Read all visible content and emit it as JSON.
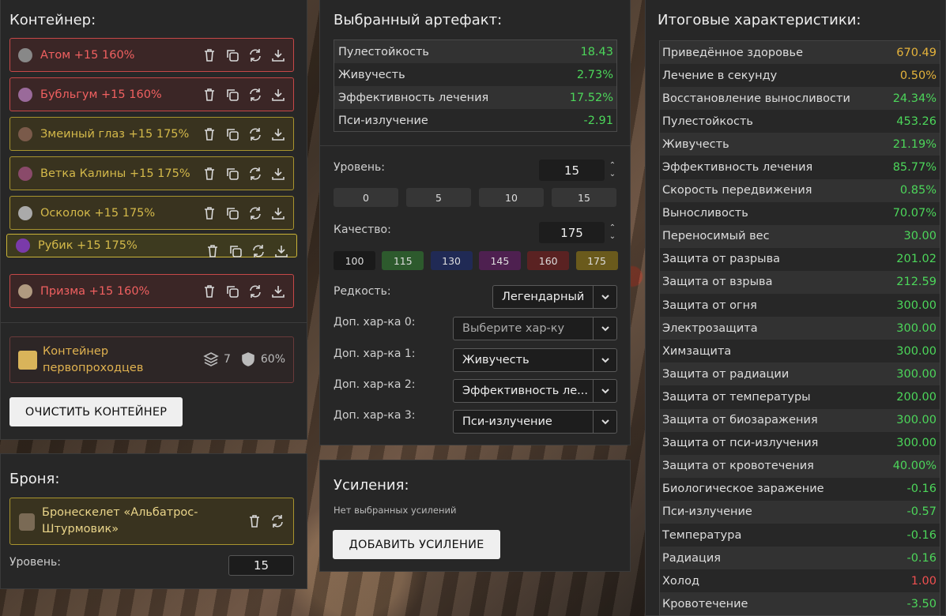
{
  "container": {
    "title": "Контейнер:",
    "artifacts": [
      {
        "name": "Атом +15 160%",
        "tier": "red",
        "color": "#888888"
      },
      {
        "name": "Бубльгум +15 160%",
        "tier": "red",
        "color": "#9a6a9a"
      },
      {
        "name": "Змеиный глаз +15 175%",
        "tier": "yellow",
        "color": "#7a5a4a"
      },
      {
        "name": "Ветка Калины +15 175%",
        "tier": "yellow",
        "color": "#8a4a6a"
      },
      {
        "name": "Осколок +15 175%",
        "tier": "yellow",
        "color": "#aaaaaa"
      },
      {
        "name": "Рубик +15 175%",
        "tier": "selected",
        "color": "#7a3aaa"
      },
      {
        "name": "Призма +15 160%",
        "tier": "red",
        "color": "#b09a80"
      }
    ],
    "card": {
      "name": "Контейнер первопроходцев",
      "slots": "7",
      "protection": "60%"
    },
    "clear_label": "ОЧИСТИТЬ КОНТЕЙНЕР"
  },
  "armor": {
    "title": "Броня:",
    "name": "Бронескелет «Альбатрос-Штурмовик»",
    "level_label": "Уровень:",
    "level": "15"
  },
  "selected": {
    "title": "Выбранный артефакт:",
    "rows": [
      {
        "label": "Пулестойкость",
        "value": "18.43"
      },
      {
        "label": "Живучесть",
        "value": "2.73%"
      },
      {
        "label": "Эффективность лечения",
        "value": "17.52%"
      },
      {
        "label": "Пси-излучение",
        "value": "-2.91"
      }
    ],
    "level_label": "Уровень:",
    "level": "15",
    "level_presets": [
      "0",
      "5",
      "10",
      "15"
    ],
    "quality_label": "Качество:",
    "quality": "175",
    "quality_presets": [
      {
        "v": "100",
        "c": "#1a1a1a"
      },
      {
        "v": "115",
        "c": "#2d5a2d"
      },
      {
        "v": "130",
        "c": "#202a55"
      },
      {
        "v": "145",
        "c": "#4e2050"
      },
      {
        "v": "160",
        "c": "#5a2222"
      },
      {
        "v": "175",
        "c": "#6a5a1c"
      }
    ],
    "rarity_label": "Редкость:",
    "rarity": "Легендарный",
    "extras": [
      {
        "label": "Доп. хар-ка 0:",
        "value": "Выберите хар-ку",
        "placeholder": true
      },
      {
        "label": "Доп. хар-ка 1:",
        "value": "Живучесть"
      },
      {
        "label": "Доп. хар-ка 2:",
        "value": "Эффективность ле..."
      },
      {
        "label": "Доп. хар-ка 3:",
        "value": "Пси-излучение"
      }
    ]
  },
  "boosts": {
    "title": "Усиления:",
    "empty": "Нет выбранных усилений",
    "add_label": "ДОБАВИТЬ УСИЛЕНИЕ"
  },
  "totals": {
    "title": "Итоговые характеристики:",
    "rows": [
      {
        "label": "Приведённое здоровье",
        "value": "670.49",
        "c": "o"
      },
      {
        "label": "Лечение в секунду",
        "value": "0.50%",
        "c": "o"
      },
      {
        "label": "Восстановление выносливости",
        "value": "24.34%",
        "c": "g"
      },
      {
        "label": "Пулестойкость",
        "value": "453.26",
        "c": "g"
      },
      {
        "label": "Живучесть",
        "value": "21.19%",
        "c": "g"
      },
      {
        "label": "Эффективность лечения",
        "value": "85.77%",
        "c": "g"
      },
      {
        "label": "Скорость передвижения",
        "value": "0.85%",
        "c": "g"
      },
      {
        "label": "Выносливость",
        "value": "70.07%",
        "c": "g"
      },
      {
        "label": "Переносимый вес",
        "value": "30.00",
        "c": "g"
      },
      {
        "label": "Защита от разрыва",
        "value": "201.02",
        "c": "g"
      },
      {
        "label": "Защита от взрыва",
        "value": "212.59",
        "c": "g"
      },
      {
        "label": "Защита от огня",
        "value": "300.00",
        "c": "g"
      },
      {
        "label": "Электрозащита",
        "value": "300.00",
        "c": "g"
      },
      {
        "label": "Химзащита",
        "value": "300.00",
        "c": "g"
      },
      {
        "label": "Защита от радиации",
        "value": "300.00",
        "c": "g"
      },
      {
        "label": "Защита от температуры",
        "value": "200.00",
        "c": "g"
      },
      {
        "label": "Защита от биозаражения",
        "value": "300.00",
        "c": "g"
      },
      {
        "label": "Защита от пси-излучения",
        "value": "300.00",
        "c": "g"
      },
      {
        "label": "Защита от кровотечения",
        "value": "40.00%",
        "c": "g"
      },
      {
        "label": "Биологическое заражение",
        "value": "-0.16",
        "c": "g"
      },
      {
        "label": "Пси-излучение",
        "value": "-0.57",
        "c": "g"
      },
      {
        "label": "Температура",
        "value": "-0.16",
        "c": "g"
      },
      {
        "label": "Радиация",
        "value": "-0.16",
        "c": "g"
      },
      {
        "label": "Холод",
        "value": "1.00",
        "c": "r"
      },
      {
        "label": "Кровотечение",
        "value": "-3.50",
        "c": "g"
      }
    ]
  }
}
